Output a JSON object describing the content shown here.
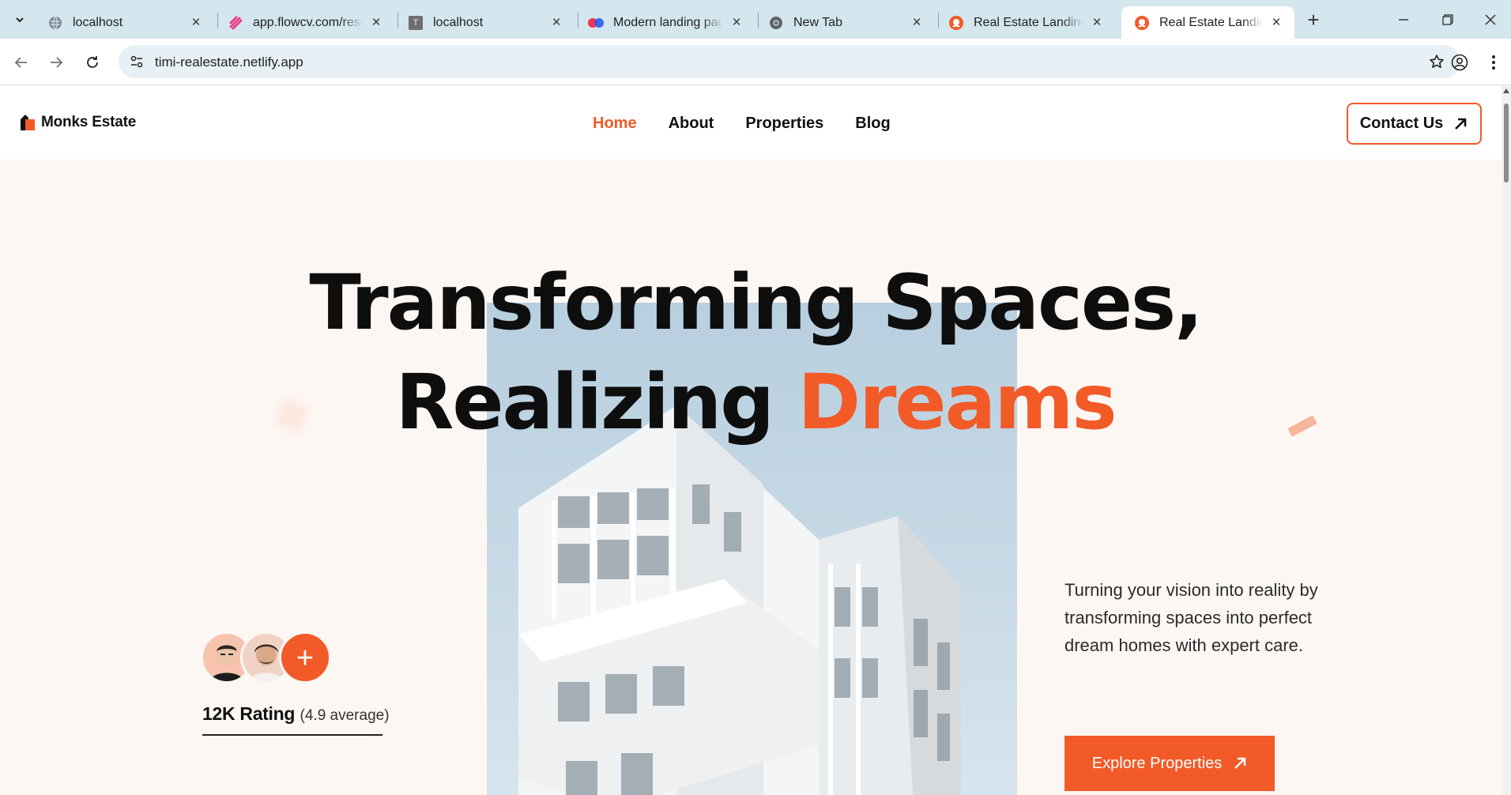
{
  "browser": {
    "tabs": [
      {
        "title": "localhost",
        "icon": "globe-icon"
      },
      {
        "title": "app.flowcv.com/resum",
        "icon": "flowcv-icon"
      },
      {
        "title": "localhost",
        "icon": "t-letter-icon",
        "icon_text": "T"
      },
      {
        "title": "Modern landing page",
        "icon": "two-dots-icon"
      },
      {
        "title": "New Tab",
        "icon": "chrome-icon"
      },
      {
        "title": "Real Estate Landing Page",
        "icon": "estate-favicon-icon"
      },
      {
        "title": "Real Estate Landing Page",
        "icon": "estate-favicon-icon",
        "active": true
      }
    ],
    "new_tab_label": "+",
    "url": "timi-realestate.netlify.app"
  },
  "site": {
    "brand": "Monks Estate",
    "nav": [
      "Home",
      "About",
      "Properties",
      "Blog"
    ],
    "active_nav": "Home",
    "contact_label": "Contact Us",
    "accent_color": "#f25a28"
  },
  "hero": {
    "title_line1": "Transforming Spaces,",
    "title_line2_plain": "Realizing",
    "title_line2_accent": "Dreams",
    "description": "Turning your vision into reality by transforming spaces into perfect dream homes with expert care.",
    "cta_label": "Explore Properties",
    "rating_count": "12K Rating",
    "rating_avg": "(4.9 average)",
    "avatar_plus": "+"
  }
}
